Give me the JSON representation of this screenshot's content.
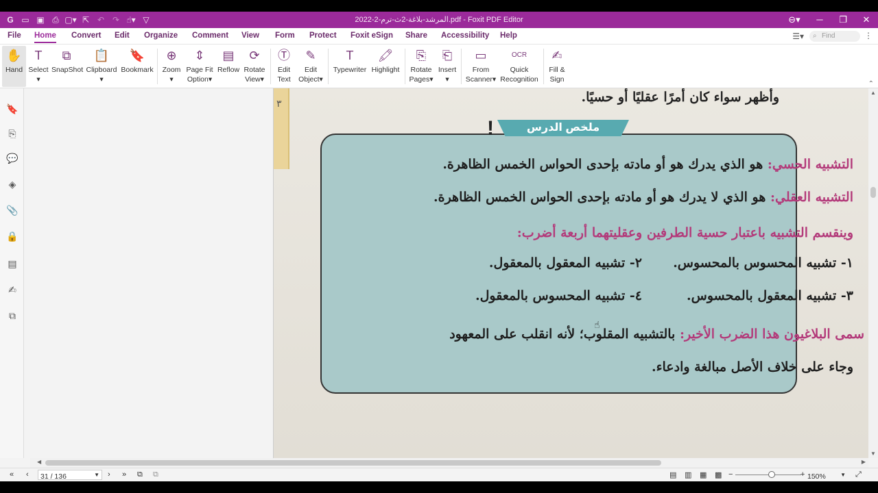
{
  "window": {
    "title": "المرشد-بلاغة-2ث-ترم-2-2022.pdf - Foxit PDF Editor",
    "controls": [
      "⊖▾",
      "─",
      "❐",
      "✕"
    ]
  },
  "menu": {
    "file": "File",
    "home": "Home",
    "convert": "Convert",
    "edit": "Edit",
    "organize": "Organize",
    "comment": "Comment",
    "view": "View",
    "form": "Form",
    "protect": "Protect",
    "esign": "Foxit eSign",
    "share": "Share",
    "accessibility": "Accessibility",
    "help": "Help",
    "find_placeholder": "Find"
  },
  "ribbon": {
    "hand": "Hand",
    "select": "Select",
    "snapshot": "SnapShot",
    "clipboard": "Clipboard",
    "bookmark": "Bookmark",
    "zoom": "Zoom",
    "pagefit1": "Page Fit",
    "pagefit2": "Option",
    "reflow": "Reflow",
    "rotate1": "Rotate",
    "rotate2": "View",
    "edittext1": "Edit",
    "edittext2": "Text",
    "editobj1": "Edit",
    "editobj2": "Object",
    "typewriter": "Typewriter",
    "highlight": "Highlight",
    "rotpages1": "Rotate",
    "rotpages2": "Pages",
    "insert": "Insert",
    "scanner1": "From",
    "scanner2": "Scanner",
    "ocr1": "Quick",
    "ocr2": "Recognition",
    "fill1": "Fill &",
    "fill2": "Sign"
  },
  "document": {
    "page_marker": "٣",
    "top_line": "وأظهر سواء كان أمرًا عقليًا أو حسيًا.",
    "badge": "ملخص الدرس",
    "lines": {
      "l1_key": "التشبيه الحسي:",
      "l1_text": " هو الذي يدرك هو أو مادته بإحدى الحواس الخمس الظاهرة.",
      "l2_key": "التشبيه العقلي:",
      "l2_text": " هو الذي لا يدرك هو أو مادته بإحدى الحواس الخمس الظاهرة.",
      "l3": "وينقسم التشبيه باعتبار حسية الطرفين وعقليتهما أربعة أضرب:",
      "l4a": "١- تشبيه المحسوس بالمحسوس.",
      "l4b": "٢- تشبيه المعقول بالمعقول.",
      "l5a": "٣- تشبيه المعقول بالمحسوس.",
      "l5b": "٤- تشبيه المحسوس بالمعقول.",
      "l6_key": "سمى البلاغيون هذا الضرب الأخير:",
      "l6_text": " بالتشبيه المقلوب؛ لأنه انقلب على المعهود",
      "l7": "وجاء على خلاف الأصل مبالغة وادعاء."
    }
  },
  "status": {
    "page_input": "31 / 136",
    "zoom": "150%"
  },
  "colors": {
    "accent": "#9b2a9a",
    "box": "#a9c9c9",
    "keyword": "#b33a7a"
  }
}
